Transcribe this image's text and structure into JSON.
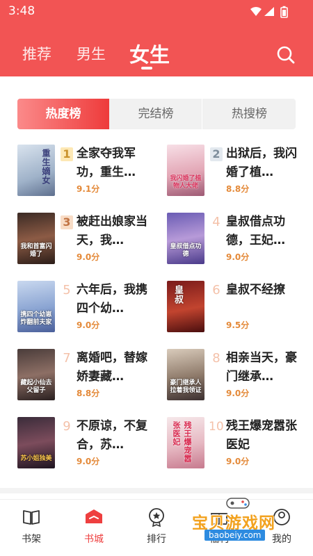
{
  "status_bar": {
    "time": "3:48"
  },
  "header": {
    "tabs": [
      {
        "label": "推荐"
      },
      {
        "label": "男生"
      },
      {
        "label": "女生",
        "active": true
      }
    ],
    "search_icon": "search-icon"
  },
  "rank_tabs": [
    {
      "label": "热度榜",
      "active": true
    },
    {
      "label": "完结榜"
    },
    {
      "label": "热搜榜"
    }
  ],
  "books": [
    {
      "rank": "1",
      "title": "全家夺我军功，重生…",
      "score": "9.1分",
      "cover_text": "重生嫡女"
    },
    {
      "rank": "2",
      "title": "出狱后，我闪婚了植…",
      "score": "8.8分",
      "cover_text": "我闪婚了植物人大佬"
    },
    {
      "rank": "3",
      "title": "被赶出娘家当天，我…",
      "score": "9.0分",
      "cover_text": "我和首富闪婚了"
    },
    {
      "rank": "4",
      "title": "皇叔借点功德，王妃…",
      "score": "9.0分",
      "cover_text": "皇叔借点功德"
    },
    {
      "rank": "5",
      "title": "六年后，我携四个幼…",
      "score": "9.0分",
      "cover_text": "携四个幼崽炸翻前夫家"
    },
    {
      "rank": "6",
      "title": "皇叔不经撩",
      "score": "9.5分",
      "cover_text": "皇叔"
    },
    {
      "rank": "7",
      "title": "离婚吧，替嫁娇妻藏…",
      "score": "8.8分",
      "cover_text": "藏起小仙去父留子"
    },
    {
      "rank": "8",
      "title": "相亲当天，豪门继承…",
      "score": "9.0分",
      "cover_text": "豪门继承人拉着我领证"
    },
    {
      "rank": "9",
      "title": "不原谅，不复合，苏…",
      "score": "9.0分",
      "cover_text": "苏小姐独美"
    },
    {
      "rank": "10",
      "title": "残王爆宠嚣张医妃",
      "score": "9.0分",
      "cover_text": "残王爆宠嚣张医妃"
    }
  ],
  "bottom_nav": [
    {
      "label": "书架",
      "icon": "book-icon"
    },
    {
      "label": "书城",
      "icon": "store-icon",
      "active": true
    },
    {
      "label": "排行",
      "icon": "rank-icon"
    },
    {
      "label": "福利",
      "icon": "gift-icon"
    },
    {
      "label": "我的",
      "icon": "profile-icon"
    }
  ],
  "watermark": {
    "text": "宝贝游戏网",
    "url": "baobeiy.com"
  },
  "colors": {
    "primary": "#f25454",
    "score": "#e48a3a",
    "active_nav": "#ee3f3f"
  }
}
